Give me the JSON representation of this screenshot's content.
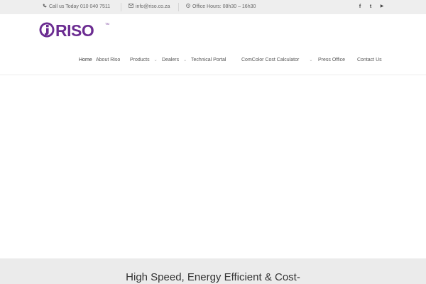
{
  "topbar": {
    "phone": {
      "icon": "phone-icon",
      "text": "Call us Today 010 040 7511"
    },
    "email": {
      "icon": "envelope-icon",
      "text": "info@riso.co.za"
    },
    "hours": {
      "icon": "clock-icon",
      "text": "Office Hours: 08h30 – 16h30"
    },
    "social": [
      {
        "icon": "facebook-icon",
        "glyph": "f"
      },
      {
        "icon": "twitter-icon",
        "glyph": "t"
      },
      {
        "icon": "youtube-icon",
        "glyph": "▶"
      }
    ]
  },
  "brand": {
    "logo_text": "RISO",
    "logo_color": "#6b2c91"
  },
  "nav": {
    "items": [
      {
        "label": "Home",
        "dropdown": false,
        "active": true
      },
      {
        "label": "About Riso",
        "dropdown": false
      },
      {
        "label": "Products",
        "dropdown": true
      },
      {
        "label": "Dealers",
        "dropdown": true
      },
      {
        "label": "Technical Portal",
        "dropdown": false
      },
      {
        "label": "ComColor Cost Calculator",
        "dropdown": true
      },
      {
        "label": "Press Office",
        "dropdown": false
      },
      {
        "label": "Contact Us",
        "dropdown": false
      }
    ]
  },
  "hero": {
    "background": "#ffffff"
  },
  "band": {
    "title": "High Speed, Energy Efficient & Cost-"
  }
}
